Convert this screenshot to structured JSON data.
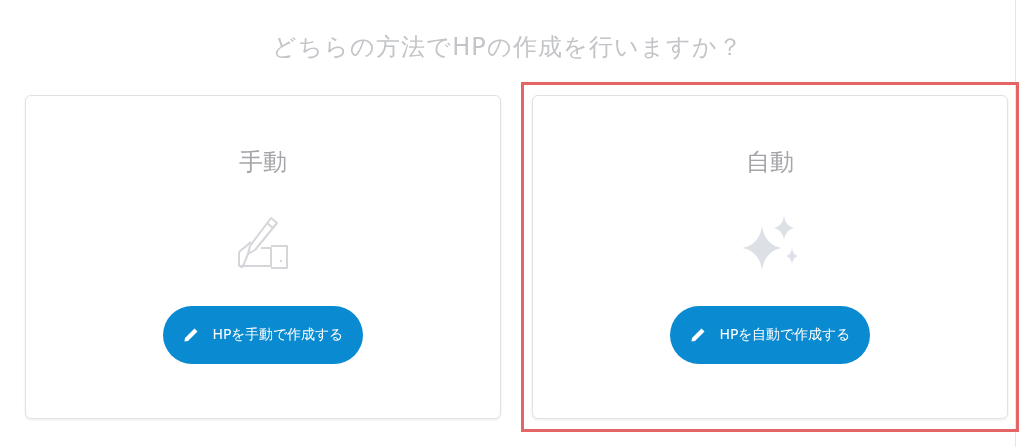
{
  "heading": "どちらの方法でHPの作成を行いますか？",
  "options": [
    {
      "title": "手動",
      "kind": "manual",
      "button": "HPを手動で作成する",
      "selected": false
    },
    {
      "title": "自動",
      "kind": "auto",
      "button": "HPを自動で作成する",
      "selected": true
    }
  ]
}
